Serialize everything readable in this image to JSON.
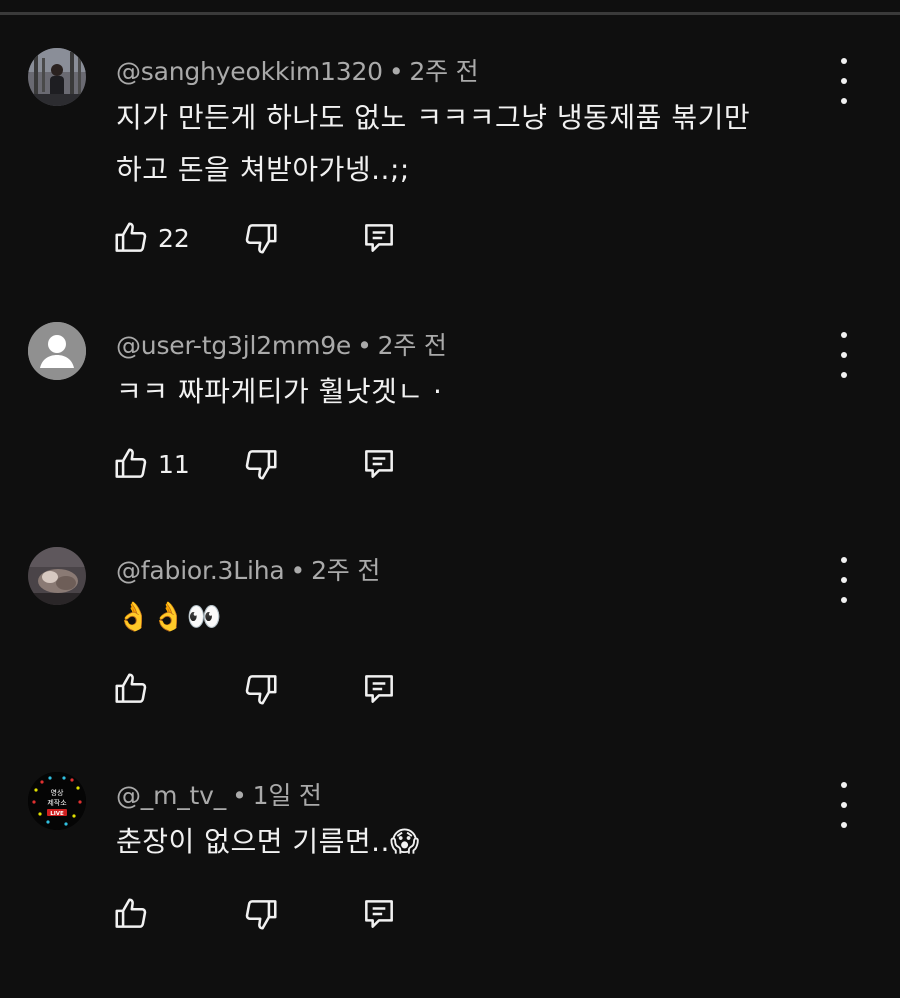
{
  "comments": [
    {
      "author": "@sanghyeokkim1320",
      "age": "2주 전",
      "lines": [
        "지가 만든게 하나도 없노 ㅋㅋㅋ그냥 냉동제품 볶기만",
        "하고 돈을 쳐받아가넹..;;"
      ],
      "likes": "22",
      "avatar_icon": "photo-avatar"
    },
    {
      "author": "@user-tg3jl2mm9e",
      "age": "2주 전",
      "lines": [
        "ㅋㅋ 짜파게티가 훨낫겟ㄴ ·"
      ],
      "likes": "11",
      "avatar_icon": "default-user-avatar"
    },
    {
      "author": "@fabior.3Liha",
      "age": "2주 전",
      "lines": [
        "👌👌👀"
      ],
      "likes": "",
      "avatar_icon": "photo-avatar"
    },
    {
      "author": "@_m_tv_",
      "age": "1일 전",
      "lines": [
        "춘장이 없으면 기름면..😱"
      ],
      "likes": "",
      "avatar_icon": "channel-logo-avatar"
    }
  ],
  "avatar_badge": {
    "line1": "영상",
    "line2": "제작소",
    "tag": "LIVE"
  },
  "colors": {
    "background": "#0f0f0f",
    "text": "#f1f1f1",
    "meta": "#aaaaaa",
    "default_avatar_bg": "#909090"
  },
  "icons": {
    "like": "thumbs-up-icon",
    "dislike": "thumbs-down-icon",
    "reply": "reply-icon",
    "more": "more-vertical-icon"
  }
}
